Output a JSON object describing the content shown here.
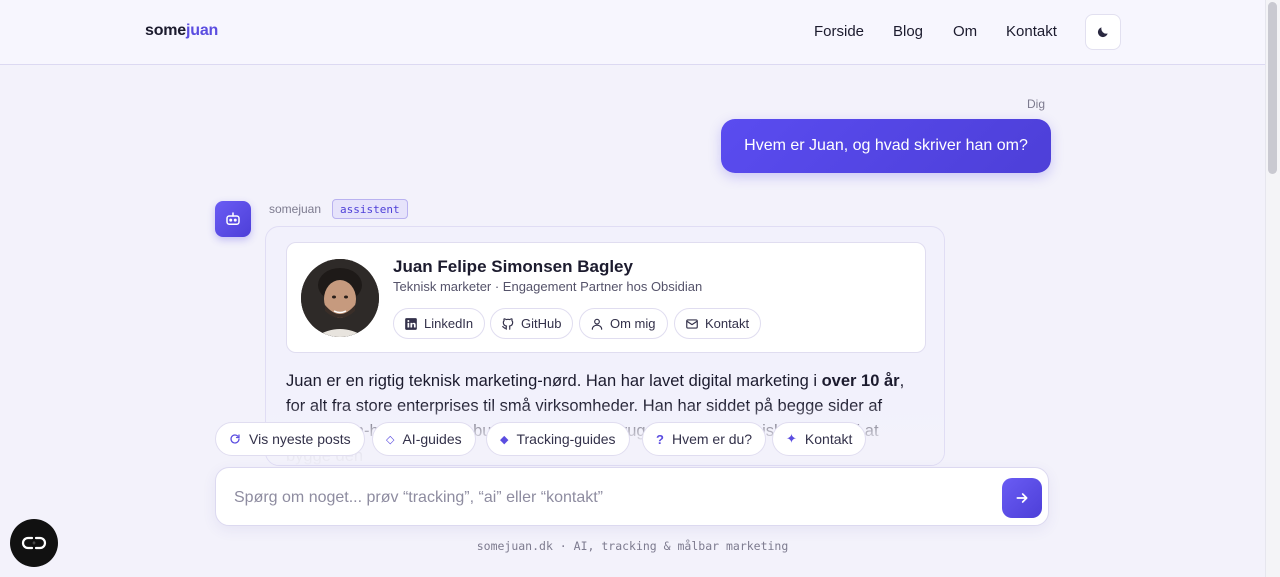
{
  "header": {
    "logo_part1": "some",
    "logo_part2": "juan",
    "nav": [
      {
        "label": "Forside"
      },
      {
        "label": "Blog"
      },
      {
        "label": "Om"
      },
      {
        "label": "Kontakt"
      }
    ],
    "theme_icon": "moon-icon"
  },
  "chat": {
    "user_label": "Dig",
    "user_message": "Hvem er Juan, og hvad skriver han om?",
    "bot_name": "somejuan",
    "bot_badge": "assistent",
    "profile": {
      "name": "Juan Felipe Simonsen Bagley",
      "role": "Teknisk marketer · Engagement Partner hos Obsidian",
      "links": [
        {
          "label": "LinkedIn",
          "icon": "linkedin-icon"
        },
        {
          "label": "GitHub",
          "icon": "github-icon"
        },
        {
          "label": "Om mig",
          "icon": "user-icon"
        },
        {
          "label": "Kontakt",
          "icon": "mail-icon"
        }
      ]
    },
    "text_part1": "Juan er en rigtig teknisk marketing-nørd. Han har lavet digital marketing i ",
    "text_bold": "over 10 år",
    "text_part2": ", for alt fra store enterprises til små virksomheder. Han har siddet på begge sider af bordet – in-house og hos bureauer – og han bruger i dag sin tekniske indsigt til at bygge den"
  },
  "quick_actions": [
    {
      "label": "Vis nyeste posts",
      "icon": "refresh-icon"
    },
    {
      "label": "AI-guides",
      "icon": "diamond-outline-icon"
    },
    {
      "label": "Tracking-guides",
      "icon": "diamond-icon"
    },
    {
      "label": "Hvem er du?",
      "icon": "question-icon"
    },
    {
      "label": "Kontakt",
      "icon": "sparkle-icon"
    }
  ],
  "input": {
    "placeholder": "Spørg om noget... prøv “tracking”, “ai” eller “kontakt”",
    "send_icon": "arrow-right-icon"
  },
  "footer": "somejuan.dk · AI, tracking & målbar marketing",
  "fab_icon": "accessibility-icon",
  "colors": {
    "accent": "#5b4de0",
    "background": "#f3f2fb",
    "bubble": "#5346e6"
  }
}
